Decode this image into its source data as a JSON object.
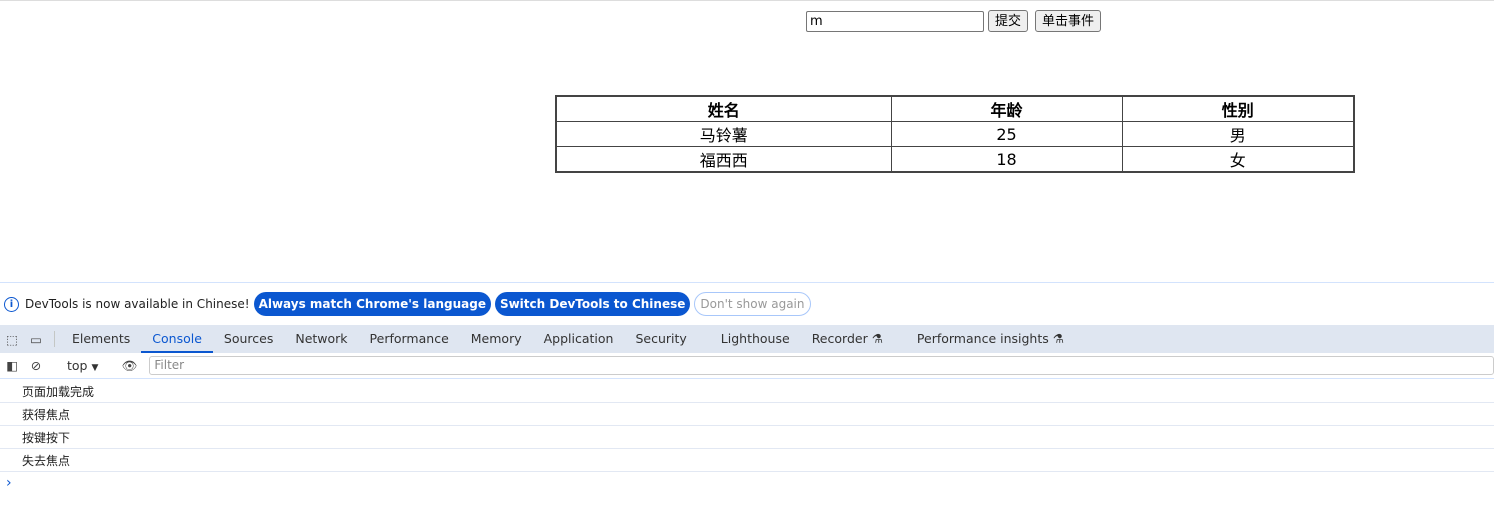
{
  "page": {
    "input_value": "m",
    "submit_label": "提交",
    "click_label": "单击事件",
    "table": {
      "headers": [
        "姓名",
        "年龄",
        "性别"
      ],
      "rows": [
        [
          "马铃薯",
          "25",
          "男"
        ],
        [
          "福西西",
          "18",
          "女"
        ]
      ]
    }
  },
  "devtools": {
    "infobar": {
      "message": "DevTools is now available in Chinese!",
      "btn_match": "Always match Chrome's language",
      "btn_switch": "Switch DevTools to Chinese",
      "btn_dismiss": "Don't show again"
    },
    "tabs": [
      "Elements",
      "Console",
      "Sources",
      "Network",
      "Performance",
      "Memory",
      "Application",
      "Security",
      "Lighthouse",
      "Recorder",
      "Performance insights"
    ],
    "active_tab": "Console",
    "context": "top",
    "filter_placeholder": "Filter",
    "logs": [
      "页面加载完成",
      "获得焦点",
      "按键按下",
      "失去焦点"
    ],
    "accent": "#0b57d0"
  }
}
